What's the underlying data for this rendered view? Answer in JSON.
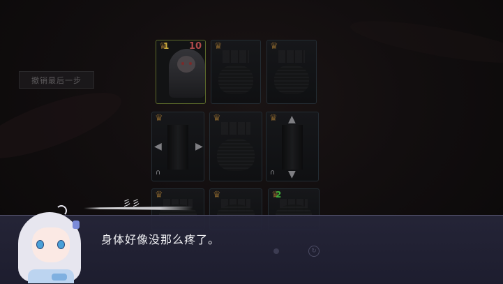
{
  "undo_button": {
    "label": "撤销最后一步"
  },
  "cards": [
    {
      "id": "c0",
      "kind": "player",
      "crown_value": "1",
      "hp": "10"
    },
    {
      "id": "c1",
      "kind": "room"
    },
    {
      "id": "c2",
      "kind": "room"
    },
    {
      "id": "c3",
      "kind": "corridor",
      "arrows": "left-right"
    },
    {
      "id": "c4",
      "kind": "room"
    },
    {
      "id": "c5",
      "kind": "corridor",
      "arrows": "up-down"
    },
    {
      "id": "c6",
      "kind": "room"
    },
    {
      "id": "c7",
      "kind": "room"
    },
    {
      "id": "c8",
      "kind": "room",
      "crown_value": "2"
    }
  ],
  "dialog": {
    "speaker": "彡彡",
    "text": "身体好像没那么疼了。"
  },
  "colors": {
    "dialog_bg": "#26263a",
    "crown_gold": "#c9a83a",
    "crown_green": "#3fae3a",
    "hp_red": "#b04a4a"
  }
}
